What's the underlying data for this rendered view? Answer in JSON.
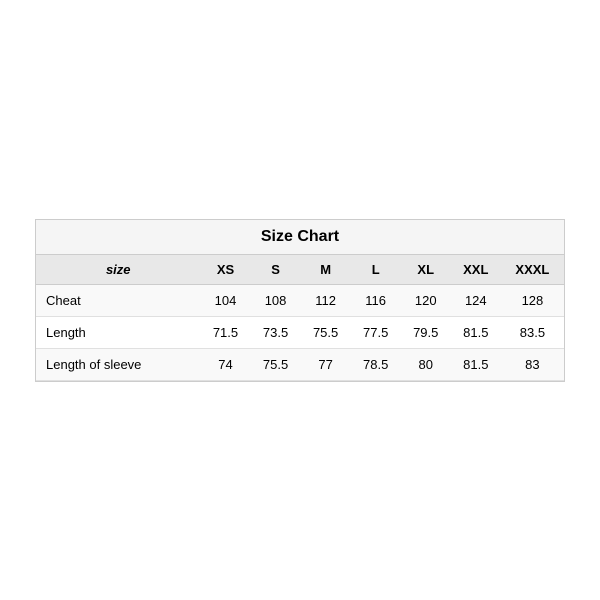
{
  "chart": {
    "title": "Size Chart",
    "headers": [
      "size",
      "XS",
      "S",
      "M",
      "L",
      "XL",
      "XXL",
      "XXXL"
    ],
    "rows": [
      {
        "label": "Cheat",
        "values": [
          "104",
          "108",
          "112",
          "116",
          "120",
          "124",
          "128"
        ]
      },
      {
        "label": "Length",
        "values": [
          "71.5",
          "73.5",
          "75.5",
          "77.5",
          "79.5",
          "81.5",
          "83.5"
        ]
      },
      {
        "label": "Length of sleeve",
        "values": [
          "74",
          "75.5",
          "77",
          "78.5",
          "80",
          "81.5",
          "83"
        ]
      }
    ]
  }
}
